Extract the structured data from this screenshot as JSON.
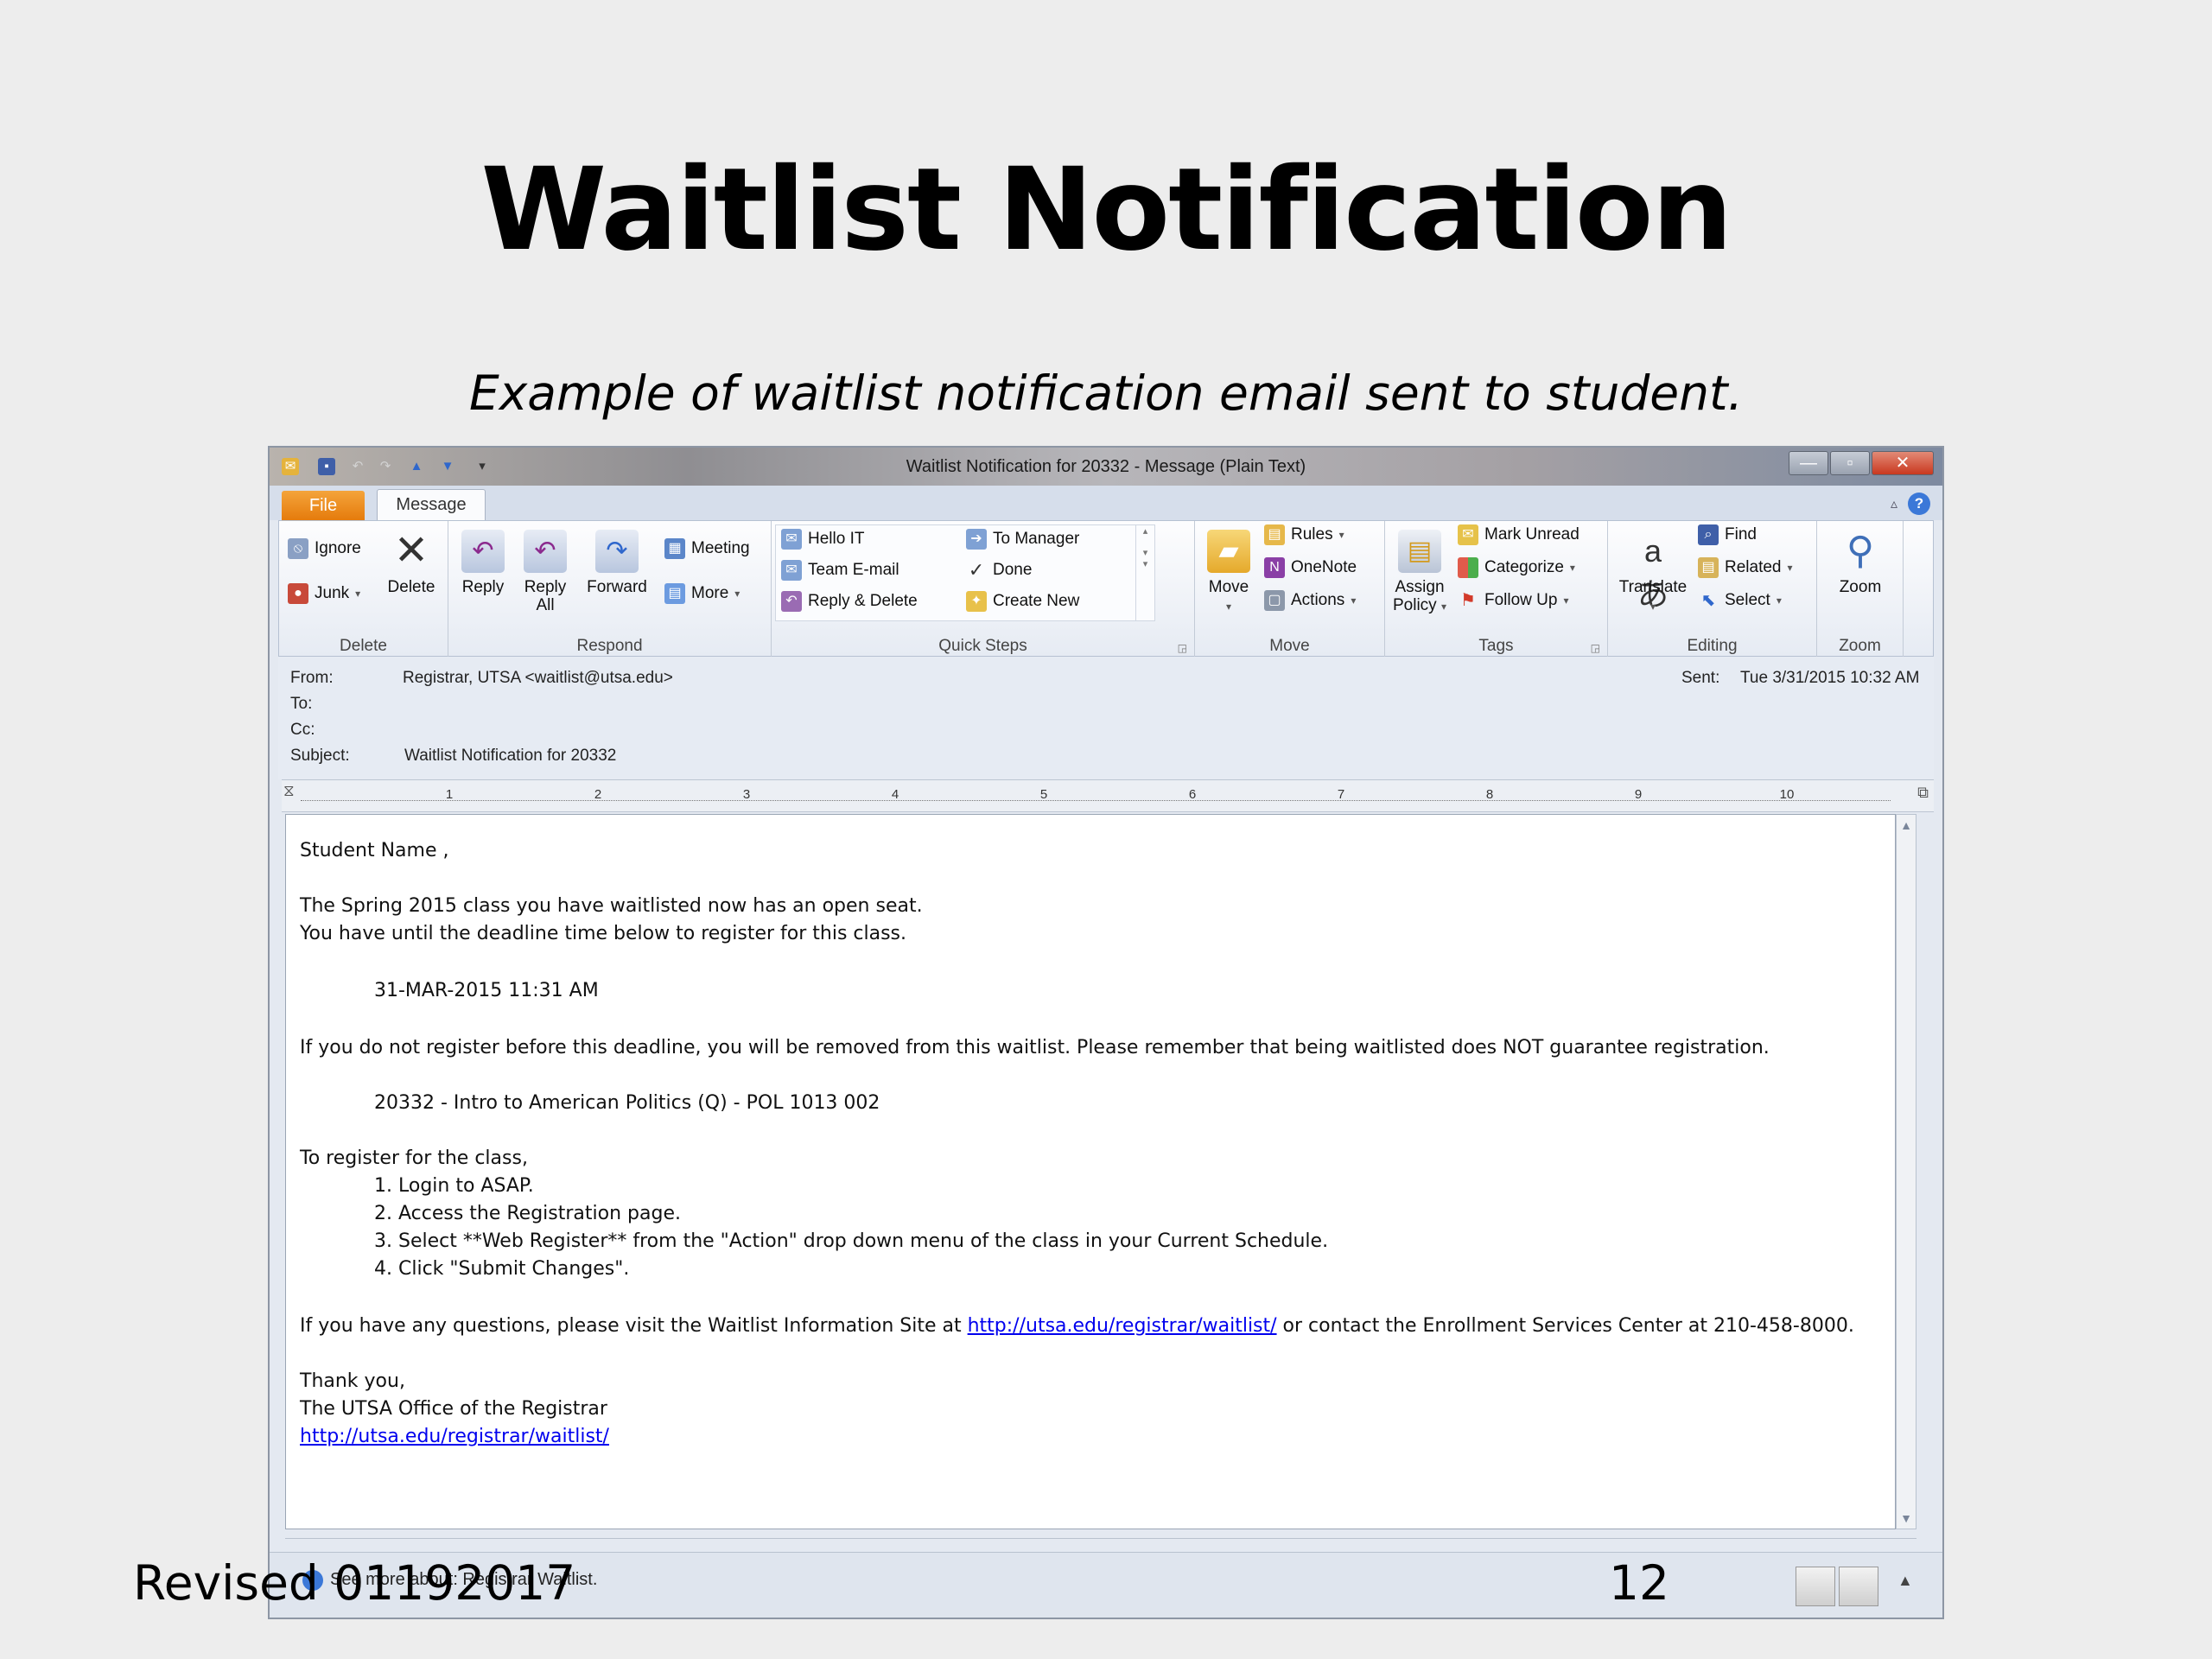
{
  "slide": {
    "title": "Waitlist Notification",
    "subtitle": "Example of waitlist notification email sent to student.",
    "revised": "Revised 01192017",
    "page_number": "12"
  },
  "window": {
    "title": "Waitlist Notification for 20332  -  Message (Plain Text)",
    "min_glyph": "—",
    "max_glyph": "▫",
    "close_glyph": "✕"
  },
  "tabs": {
    "file": "File",
    "message": "Message"
  },
  "ribbon": {
    "delete_group": {
      "label": "Delete",
      "ignore": "Ignore",
      "junk": "Junk",
      "delete": "Delete"
    },
    "respond_group": {
      "label": "Respond",
      "reply": "Reply",
      "reply_all_1": "Reply",
      "reply_all_2": "All",
      "forward": "Forward",
      "meeting": "Meeting",
      "more": "More"
    },
    "quick_steps_group": {
      "label": "Quick Steps",
      "hello_it": "Hello IT",
      "team_email": "Team E-mail",
      "reply_delete": "Reply & Delete",
      "to_manager": "To Manager",
      "done": "Done",
      "create_new": "Create New"
    },
    "move_group": {
      "label": "Move",
      "move": "Move",
      "rules": "Rules",
      "onenote": "OneNote",
      "actions": "Actions"
    },
    "tags_group": {
      "label": "Tags",
      "assign_policy_1": "Assign",
      "assign_policy_2": "Policy",
      "mark_unread": "Mark Unread",
      "categorize": "Categorize",
      "follow_up": "Follow Up"
    },
    "editing_group": {
      "label": "Editing",
      "translate": "Translate",
      "find": "Find",
      "related": "Related",
      "select": "Select"
    },
    "zoom_group": {
      "label": "Zoom",
      "zoom": "Zoom"
    }
  },
  "header": {
    "from_label": "From:",
    "from_value": "Registrar, UTSA  <waitlist@utsa.edu>",
    "to_label": "To:",
    "cc_label": "Cc:",
    "subject_label": "Subject:",
    "subject_value": "Waitlist Notification for 20332",
    "sent_label": "Sent:",
    "sent_value": "Tue 3/31/2015 10:32 AM"
  },
  "ruler": {
    "numbers": [
      "1",
      "2",
      "3",
      "4",
      "5",
      "6",
      "7",
      "8",
      "9",
      "10"
    ]
  },
  "body": {
    "greeting": "Student Name ,",
    "line1": "The Spring 2015  class you have waitlisted now has an open seat.",
    "line2": "You have until the deadline time below to register for this class.",
    "deadline": "31-MAR-2015 11:31 AM",
    "warning": "If you do not register before this deadline, you will be removed from this waitlist. Please remember that being waitlisted does NOT guarantee registration.",
    "course": "20332  - Intro to American Politics (Q)  - POL 1013 002",
    "register_intro": "To register for the class,",
    "step1": "1. Login to ASAP.",
    "step2": "2. Access the Registration page.",
    "step3": "3. Select **Web Register** from the \"Action\" drop down menu of the class in your Current Schedule.",
    "step4": "4. Click \"Submit Changes\".",
    "questions_pre": "If you have any questions, please visit the Waitlist Information Site at ",
    "questions_link": "http://utsa.edu/registrar/waitlist/",
    "questions_post": " or contact the Enrollment Services Center at 210-458-8000.",
    "thanks": "Thank you,",
    "signature": "The UTSA Office of the Registrar",
    "signature_link": "http://utsa.edu/registrar/waitlist/"
  },
  "status": {
    "text": "See more about: Registrar Waitlist."
  },
  "colors": {
    "file_tab": "#e57b0c",
    "link": "#0000ee",
    "close_button": "#c9381f",
    "help": "#3b78d8"
  }
}
